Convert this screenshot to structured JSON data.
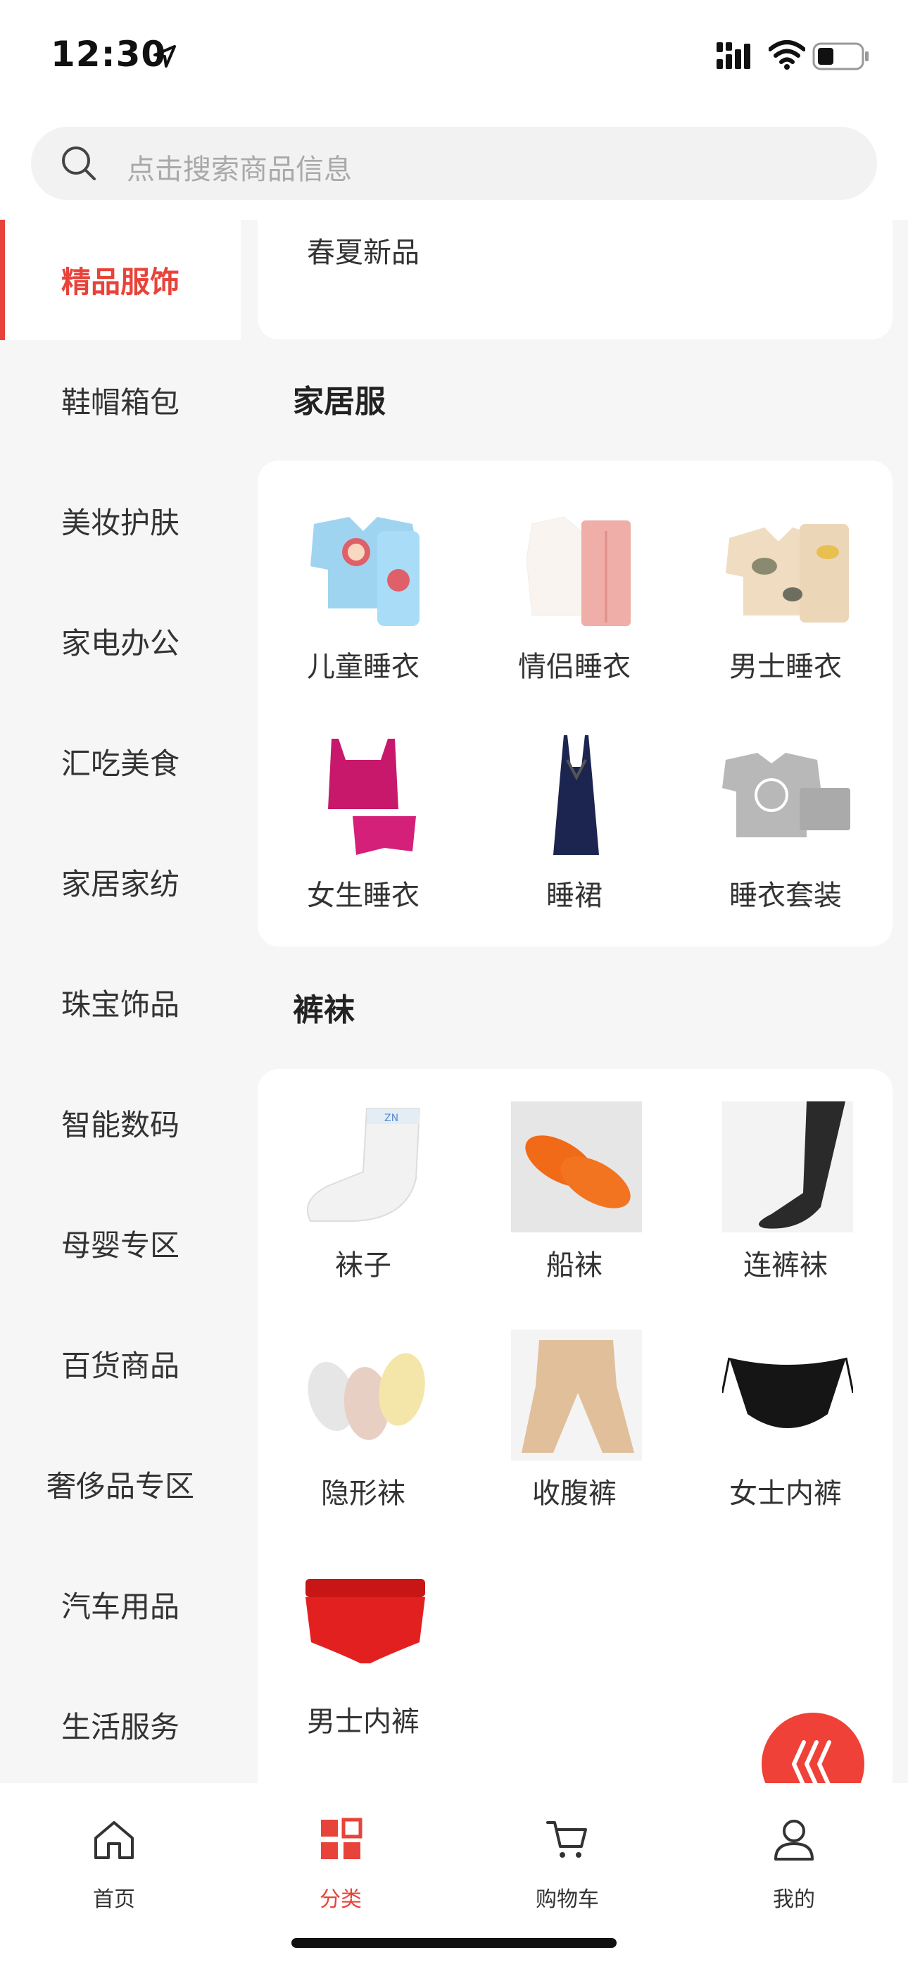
{
  "status_bar": {
    "time": "12:30"
  },
  "search": {
    "placeholder": "点击搜索商品信息"
  },
  "sidebar": {
    "items": [
      {
        "label": "精品服饰",
        "active": true
      },
      {
        "label": "鞋帽箱包"
      },
      {
        "label": "美妆护肤"
      },
      {
        "label": "家电办公"
      },
      {
        "label": "汇吃美食"
      },
      {
        "label": "家居家纺"
      },
      {
        "label": "珠宝饰品"
      },
      {
        "label": "智能数码"
      },
      {
        "label": "母婴专区"
      },
      {
        "label": "百货商品"
      },
      {
        "label": "奢侈品专区"
      },
      {
        "label": "汽车用品"
      },
      {
        "label": "生活服务"
      }
    ]
  },
  "sections": [
    {
      "title": "",
      "items": [
        {
          "label": "春夏新品"
        }
      ]
    },
    {
      "title": "家居服",
      "items": [
        {
          "label": "儿童睡衣"
        },
        {
          "label": "情侣睡衣"
        },
        {
          "label": "男士睡衣"
        },
        {
          "label": "女生睡衣"
        },
        {
          "label": "睡裙"
        },
        {
          "label": "睡衣套装"
        }
      ]
    },
    {
      "title": "裤袜",
      "items": [
        {
          "label": "袜子"
        },
        {
          "label": "船袜"
        },
        {
          "label": "连裤袜"
        },
        {
          "label": "隐形袜"
        },
        {
          "label": "收腹裤"
        },
        {
          "label": "女士内裤"
        },
        {
          "label": "男士内裤"
        }
      ]
    }
  ],
  "tab_bar": {
    "tabs": [
      {
        "label": "首页",
        "icon": "home-icon"
      },
      {
        "label": "分类",
        "icon": "category-icon",
        "active": true
      },
      {
        "label": "购物车",
        "icon": "cart-icon"
      },
      {
        "label": "我的",
        "icon": "profile-icon"
      }
    ]
  },
  "colors": {
    "accent": "#e8433a",
    "sidebar_bg": "#f6f6f6",
    "fab": "#ef4137"
  }
}
